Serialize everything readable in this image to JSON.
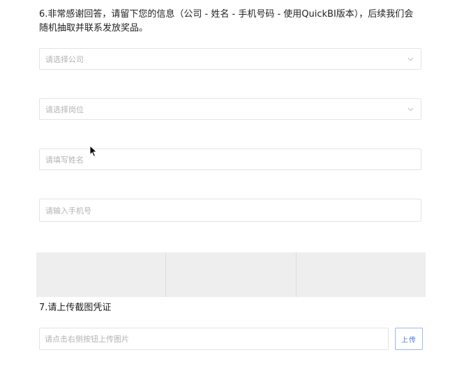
{
  "question6": {
    "title": "6.非常感谢回答，请留下您的信息（公司 - 姓名 - 手机号码 - 使用QuickBI版本），后续我们会随机抽取并联系发放奖品。"
  },
  "fields": {
    "company_placeholder": "请选择公司",
    "position_placeholder": "请选择岗位",
    "name_placeholder": "请填写姓名",
    "phone_placeholder": "请输入手机号"
  },
  "question7": {
    "title": "7.请上传截图凭证",
    "upload_placeholder": "请点击右侧按钮上传图片",
    "upload_button": "上传"
  },
  "icons": {
    "select_arrow": "chevron-down-icon",
    "cursor": "mouse-pointer-icon"
  },
  "colors": {
    "accent": "#4a7fd9",
    "placeholder": "#b3b3b3",
    "border": "#e3e3e3"
  }
}
